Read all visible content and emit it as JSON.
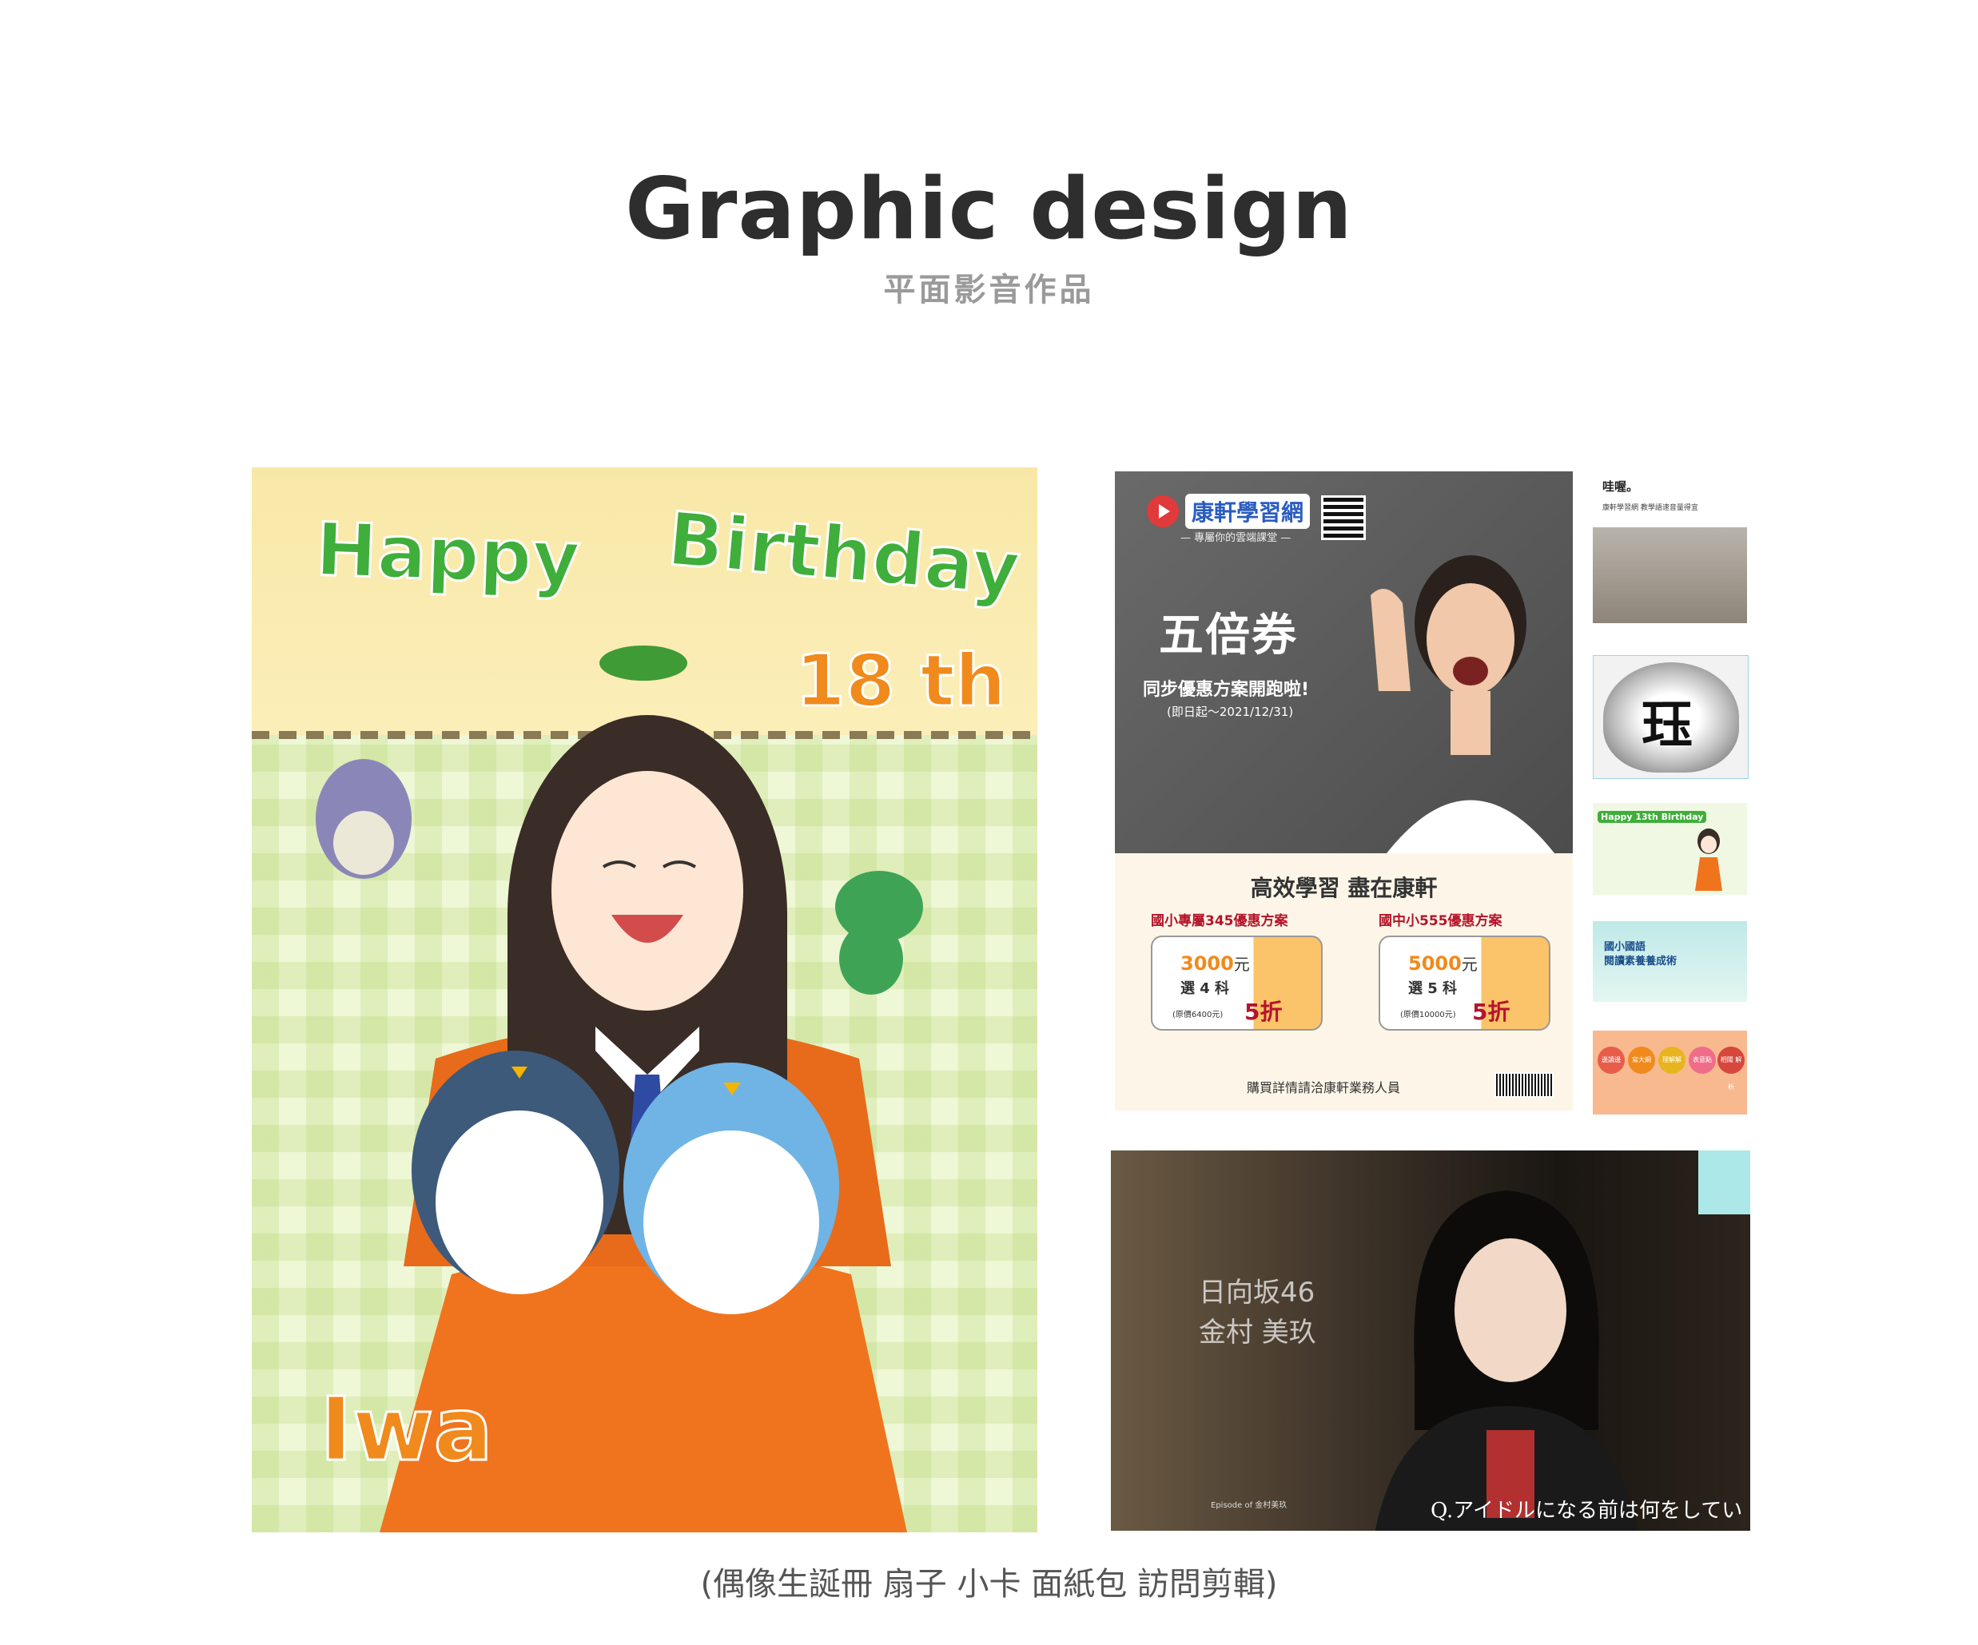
{
  "header": {
    "title": "Graphic design",
    "subtitle": "平面影音作品"
  },
  "birthday_card": {
    "happy": "Happy",
    "birthday": "Birthday",
    "age": "18 th",
    "name": "Iwa"
  },
  "ad": {
    "logo": "康軒學習網",
    "logo_sub": "— 專屬你的雲端課堂 —",
    "headline": "五倍券",
    "sub1": "同步優惠方案開跑啦!",
    "sub2": "(即日起～2021/12/31)",
    "banner": "高效學習 盡在康軒",
    "plans": [
      {
        "title": "國小專屬345優惠方案",
        "price": "3000",
        "price_unit": "元",
        "subjects": "選 4 科",
        "original": "(原價6400元)",
        "discount": "5折"
      },
      {
        "title": "國中小555優惠方案",
        "price": "5000",
        "price_unit": "元",
        "subjects": "選 5 科",
        "original": "(原價10000元)",
        "discount": "5折"
      }
    ],
    "contact": "購買詳情請洽康軒業務人員"
  },
  "thumbnails": {
    "t1_title": "哇喔。",
    "t1_line": "康軒學習網 教學語速音量得宜",
    "t2_char": "珏",
    "t3_label": "Happy 13th Birthday",
    "t4_line1": "國小國語",
    "t4_line2": "閱讀素養養成術",
    "t5_items": [
      "邊讀邊",
      "寫大綱",
      "理解解",
      "表意點",
      "相關 解析"
    ]
  },
  "video": {
    "group": "日向坂46",
    "member": "金村 美玖",
    "subtitle": "Q.アイドルになる前は何をしてい",
    "episode": "Episode of 金村美玖"
  },
  "caption": "(偶像生誕冊 扇子 小卡 面紙包  訪問剪輯)"
}
